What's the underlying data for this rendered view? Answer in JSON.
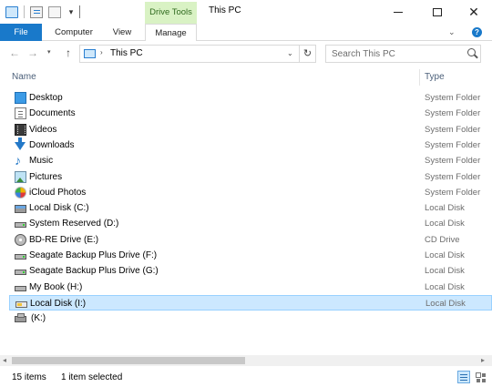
{
  "window": {
    "title": "This PC",
    "context_tab": "Drive Tools"
  },
  "ribbon": {
    "tabs": [
      {
        "label": "File"
      },
      {
        "label": "Computer"
      },
      {
        "label": "View"
      },
      {
        "label": "Manage"
      }
    ],
    "help_label": "?"
  },
  "nav": {
    "address_crumb": "This PC",
    "search_placeholder": "Search This PC"
  },
  "columns": {
    "name": "Name",
    "type": "Type"
  },
  "items": [
    {
      "name": "Desktop",
      "type": "System Folder",
      "icon": "desktop-folder-icon"
    },
    {
      "name": "Documents",
      "type": "System Folder",
      "icon": "documents-folder-icon"
    },
    {
      "name": "Videos",
      "type": "System Folder",
      "icon": "videos-folder-icon"
    },
    {
      "name": "Downloads",
      "type": "System Folder",
      "icon": "downloads-folder-icon"
    },
    {
      "name": "Music",
      "type": "System Folder",
      "icon": "music-folder-icon"
    },
    {
      "name": "Pictures",
      "type": "System Folder",
      "icon": "pictures-folder-icon"
    },
    {
      "name": "iCloud Photos",
      "type": "System Folder",
      "icon": "icloud-photos-icon"
    },
    {
      "name": "Local Disk (C:)",
      "type": "Local Disk",
      "icon": "windows-drive-icon"
    },
    {
      "name": "System Reserved (D:)",
      "type": "Local Disk",
      "icon": "hard-drive-icon"
    },
    {
      "name": "BD-RE Drive (E:)",
      "type": "CD Drive",
      "icon": "optical-drive-icon"
    },
    {
      "name": "Seagate Backup Plus Drive (F:)",
      "type": "Local Disk",
      "icon": "hard-drive-icon"
    },
    {
      "name": "Seagate Backup Plus Drive (G:)",
      "type": "Local Disk",
      "icon": "hard-drive-icon"
    },
    {
      "name": "My Book (H:)",
      "type": "Local Disk",
      "icon": "hard-drive-icon"
    },
    {
      "name": "Local Disk (I:)",
      "type": "Local Disk",
      "icon": "usb-drive-icon",
      "selected": true
    },
    {
      "name": "(K:)",
      "type": "",
      "icon": "network-drive-icon"
    }
  ],
  "status": {
    "item_count": "15 items",
    "selection": "1 item selected"
  }
}
